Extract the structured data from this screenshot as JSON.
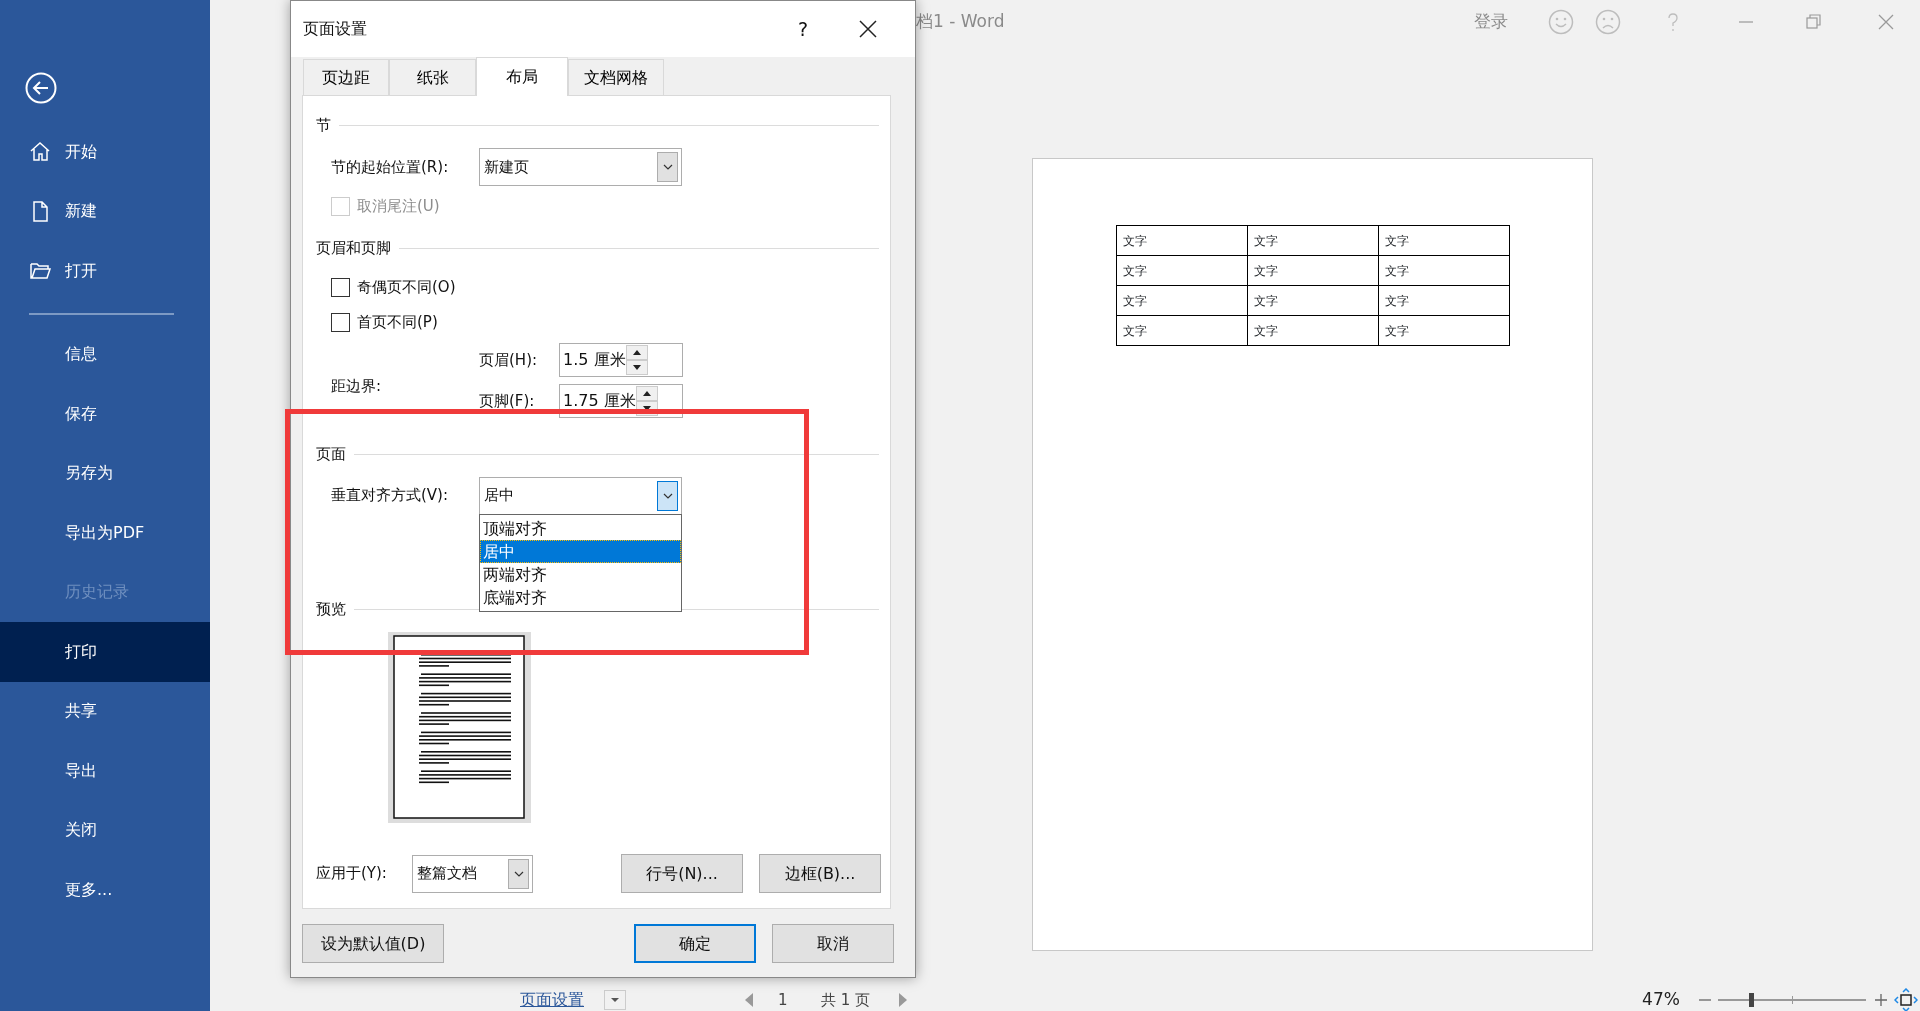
{
  "window": {
    "title": "档1 - Word",
    "sign_in": "登录"
  },
  "backstage": {
    "primary_items": [
      {
        "label": "开始",
        "selected": false,
        "disabled": false
      },
      {
        "label": "新建",
        "selected": false,
        "disabled": false
      },
      {
        "label": "打开",
        "selected": false,
        "disabled": false
      }
    ],
    "secondary_items": [
      {
        "label": "信息",
        "selected": false,
        "disabled": false
      },
      {
        "label": "保存",
        "selected": false,
        "disabled": false
      },
      {
        "label": "另存为",
        "selected": false,
        "disabled": false
      },
      {
        "label": "导出为PDF",
        "selected": false,
        "disabled": false
      },
      {
        "label": "历史记录",
        "selected": false,
        "disabled": true
      },
      {
        "label": "打印",
        "selected": true,
        "disabled": false
      },
      {
        "label": "共享",
        "selected": false,
        "disabled": false
      },
      {
        "label": "导出",
        "selected": false,
        "disabled": false
      },
      {
        "label": "关闭",
        "selected": false,
        "disabled": false
      },
      {
        "label": "更多...",
        "selected": false,
        "disabled": false
      }
    ]
  },
  "document": {
    "table": {
      "rows": [
        [
          "文字",
          "文字",
          "文字"
        ],
        [
          "文字",
          "文字",
          "文字"
        ],
        [
          "文字",
          "文字",
          "文字"
        ],
        [
          "文字",
          "文字",
          "文字"
        ]
      ]
    }
  },
  "status_bar": {
    "page_setup_link": "页面设置",
    "page_number": "1",
    "page_total": "共 1 页",
    "zoom": "47%",
    "zoom_slider": {
      "level": 0.22
    }
  },
  "dialog": {
    "title": "页面设置",
    "help": "?",
    "tabs": [
      {
        "label": "页边距",
        "selected": false
      },
      {
        "label": "纸张",
        "selected": false
      },
      {
        "label": "布局",
        "selected": true
      },
      {
        "label": "文档网格",
        "selected": false
      }
    ],
    "section": {
      "heading": "节",
      "start_label": "节的起始位置(R):",
      "start_value": "新建页",
      "suppress_endnotes": {
        "label": "取消尾注(U)",
        "checked": false,
        "disabled": true
      }
    },
    "headers_footers": {
      "heading": "页眉和页脚",
      "checkboxes": [
        {
          "label": "奇偶页不同(O)",
          "checked": false,
          "disabled": false
        },
        {
          "label": "首页不同(P)",
          "checked": false,
          "disabled": false
        }
      ],
      "distance_label": "距边界:",
      "header": {
        "label": "页眉(H):",
        "value": "1.5 厘米"
      },
      "footer": {
        "label": "页脚(F):",
        "value": "1.75 厘米"
      }
    },
    "page": {
      "heading": "页面",
      "valign_label": "垂直对齐方式(V):",
      "valign_value": "居中",
      "expanded": true,
      "options": [
        {
          "label": "顶端对齐",
          "selected": false
        },
        {
          "label": "居中",
          "selected": true
        },
        {
          "label": "两端对齐",
          "selected": false
        },
        {
          "label": "底端对齐",
          "selected": false
        }
      ]
    },
    "preview": {
      "heading": "预览"
    },
    "apply_label": "应用于(Y):",
    "apply_value": "整篇文档",
    "panel_buttons": [
      "行号(N)...",
      "边框(B)..."
    ],
    "footer_buttons": [
      {
        "label": "设为默认值(D)",
        "kind": "normal"
      },
      {
        "label": "确定",
        "kind": "default"
      },
      {
        "label": "取消",
        "kind": "normal"
      }
    ]
  },
  "annotation": {
    "kind": "highlight-frame"
  }
}
